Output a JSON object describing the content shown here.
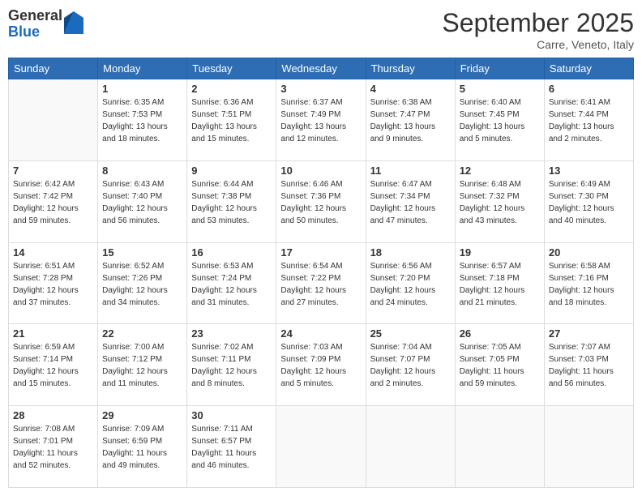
{
  "logo": {
    "general": "General",
    "blue": "Blue"
  },
  "header": {
    "month": "September 2025",
    "location": "Carre, Veneto, Italy"
  },
  "weekdays": [
    "Sunday",
    "Monday",
    "Tuesday",
    "Wednesday",
    "Thursday",
    "Friday",
    "Saturday"
  ],
  "weeks": [
    [
      {
        "day": "",
        "info": ""
      },
      {
        "day": "1",
        "sunrise": "6:35 AM",
        "sunset": "7:53 PM",
        "daylight": "13 hours and 18 minutes."
      },
      {
        "day": "2",
        "sunrise": "6:36 AM",
        "sunset": "7:51 PM",
        "daylight": "13 hours and 15 minutes."
      },
      {
        "day": "3",
        "sunrise": "6:37 AM",
        "sunset": "7:49 PM",
        "daylight": "13 hours and 12 minutes."
      },
      {
        "day": "4",
        "sunrise": "6:38 AM",
        "sunset": "7:47 PM",
        "daylight": "13 hours and 9 minutes."
      },
      {
        "day": "5",
        "sunrise": "6:40 AM",
        "sunset": "7:45 PM",
        "daylight": "13 hours and 5 minutes."
      },
      {
        "day": "6",
        "sunrise": "6:41 AM",
        "sunset": "7:44 PM",
        "daylight": "13 hours and 2 minutes."
      }
    ],
    [
      {
        "day": "7",
        "sunrise": "6:42 AM",
        "sunset": "7:42 PM",
        "daylight": "12 hours and 59 minutes."
      },
      {
        "day": "8",
        "sunrise": "6:43 AM",
        "sunset": "7:40 PM",
        "daylight": "12 hours and 56 minutes."
      },
      {
        "day": "9",
        "sunrise": "6:44 AM",
        "sunset": "7:38 PM",
        "daylight": "12 hours and 53 minutes."
      },
      {
        "day": "10",
        "sunrise": "6:46 AM",
        "sunset": "7:36 PM",
        "daylight": "12 hours and 50 minutes."
      },
      {
        "day": "11",
        "sunrise": "6:47 AM",
        "sunset": "7:34 PM",
        "daylight": "12 hours and 47 minutes."
      },
      {
        "day": "12",
        "sunrise": "6:48 AM",
        "sunset": "7:32 PM",
        "daylight": "12 hours and 43 minutes."
      },
      {
        "day": "13",
        "sunrise": "6:49 AM",
        "sunset": "7:30 PM",
        "daylight": "12 hours and 40 minutes."
      }
    ],
    [
      {
        "day": "14",
        "sunrise": "6:51 AM",
        "sunset": "7:28 PM",
        "daylight": "12 hours and 37 minutes."
      },
      {
        "day": "15",
        "sunrise": "6:52 AM",
        "sunset": "7:26 PM",
        "daylight": "12 hours and 34 minutes."
      },
      {
        "day": "16",
        "sunrise": "6:53 AM",
        "sunset": "7:24 PM",
        "daylight": "12 hours and 31 minutes."
      },
      {
        "day": "17",
        "sunrise": "6:54 AM",
        "sunset": "7:22 PM",
        "daylight": "12 hours and 27 minutes."
      },
      {
        "day": "18",
        "sunrise": "6:56 AM",
        "sunset": "7:20 PM",
        "daylight": "12 hours and 24 minutes."
      },
      {
        "day": "19",
        "sunrise": "6:57 AM",
        "sunset": "7:18 PM",
        "daylight": "12 hours and 21 minutes."
      },
      {
        "day": "20",
        "sunrise": "6:58 AM",
        "sunset": "7:16 PM",
        "daylight": "12 hours and 18 minutes."
      }
    ],
    [
      {
        "day": "21",
        "sunrise": "6:59 AM",
        "sunset": "7:14 PM",
        "daylight": "12 hours and 15 minutes."
      },
      {
        "day": "22",
        "sunrise": "7:00 AM",
        "sunset": "7:12 PM",
        "daylight": "12 hours and 11 minutes."
      },
      {
        "day": "23",
        "sunrise": "7:02 AM",
        "sunset": "7:11 PM",
        "daylight": "12 hours and 8 minutes."
      },
      {
        "day": "24",
        "sunrise": "7:03 AM",
        "sunset": "7:09 PM",
        "daylight": "12 hours and 5 minutes."
      },
      {
        "day": "25",
        "sunrise": "7:04 AM",
        "sunset": "7:07 PM",
        "daylight": "12 hours and 2 minutes."
      },
      {
        "day": "26",
        "sunrise": "7:05 AM",
        "sunset": "7:05 PM",
        "daylight": "11 hours and 59 minutes."
      },
      {
        "day": "27",
        "sunrise": "7:07 AM",
        "sunset": "7:03 PM",
        "daylight": "11 hours and 56 minutes."
      }
    ],
    [
      {
        "day": "28",
        "sunrise": "7:08 AM",
        "sunset": "7:01 PM",
        "daylight": "11 hours and 52 minutes."
      },
      {
        "day": "29",
        "sunrise": "7:09 AM",
        "sunset": "6:59 PM",
        "daylight": "11 hours and 49 minutes."
      },
      {
        "day": "30",
        "sunrise": "7:11 AM",
        "sunset": "6:57 PM",
        "daylight": "11 hours and 46 minutes."
      },
      {
        "day": "",
        "info": ""
      },
      {
        "day": "",
        "info": ""
      },
      {
        "day": "",
        "info": ""
      },
      {
        "day": "",
        "info": ""
      }
    ]
  ]
}
